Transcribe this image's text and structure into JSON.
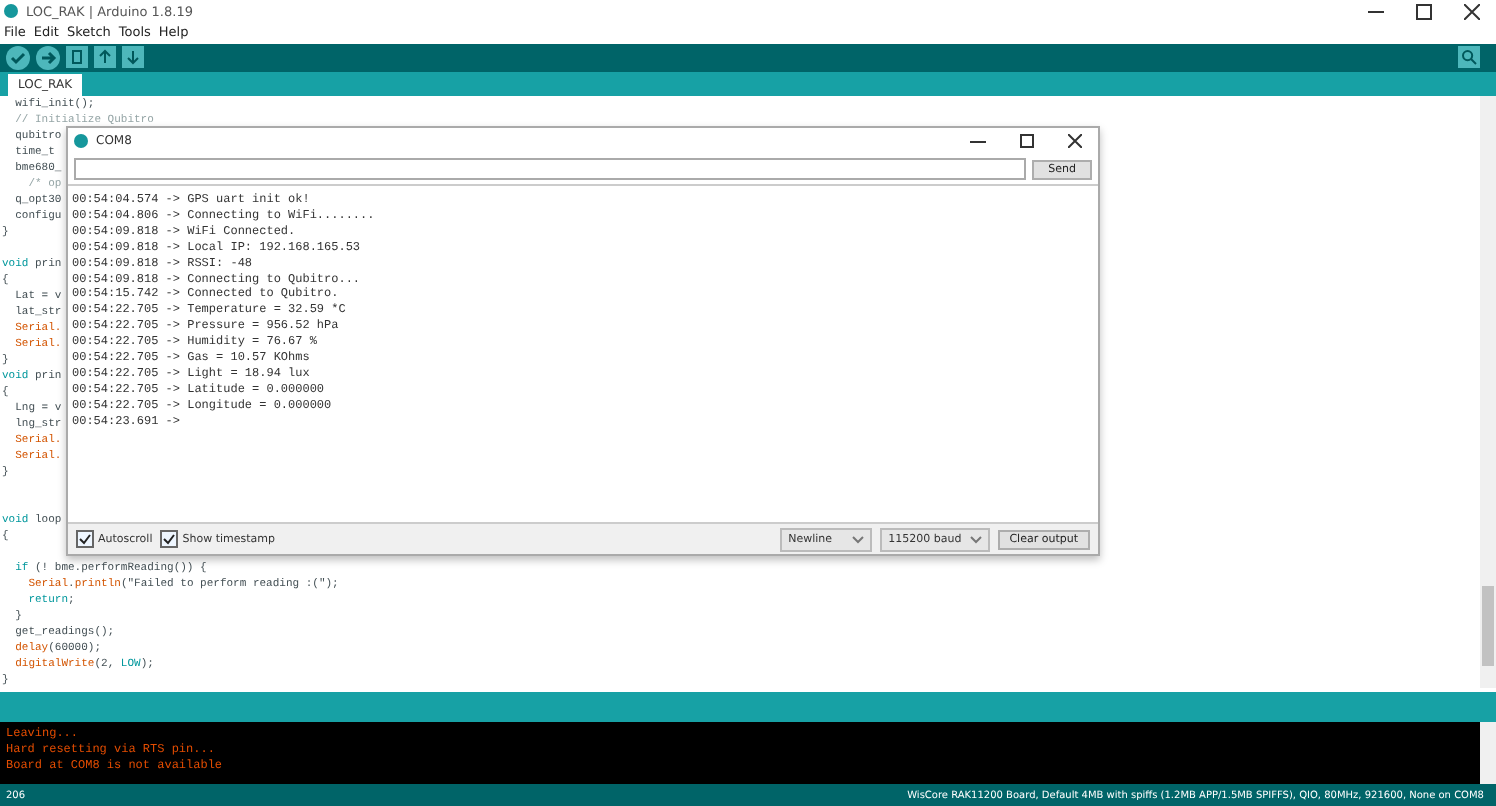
{
  "window": {
    "title": "LOC_RAK | Arduino 1.8.19"
  },
  "menu": [
    "File",
    "Edit",
    "Sketch",
    "Tools",
    "Help"
  ],
  "toolbar": [
    {
      "kind": "verify"
    },
    {
      "kind": "upload"
    },
    {
      "kind": "new"
    },
    {
      "kind": "open"
    },
    {
      "kind": "save"
    }
  ],
  "tabs": [
    {
      "label": "LOC_RAK",
      "selected": true
    }
  ],
  "editor": {
    "lines": [
      {
        "kind": "code",
        "tokens": [
          {
            "text": "  wifi_init();",
            "kind": "plain"
          }
        ]
      },
      {
        "kind": "code",
        "tokens": [
          {
            "text": "  // Initialize Qubitro",
            "kind": "comment"
          }
        ]
      },
      {
        "kind": "code",
        "tokens": [
          {
            "text": "  qubitro",
            "kind": "plain"
          }
        ]
      },
      {
        "kind": "code",
        "tokens": [
          {
            "text": "  time_t",
            "kind": "plain"
          }
        ]
      },
      {
        "kind": "code",
        "tokens": [
          {
            "text": "  bme680_",
            "kind": "plain"
          }
        ]
      },
      {
        "kind": "code",
        "tokens": [
          {
            "text": "    /* op",
            "kind": "comment"
          }
        ]
      },
      {
        "kind": "code",
        "tokens": [
          {
            "text": "  q_opt30",
            "kind": "plain"
          }
        ]
      },
      {
        "kind": "code",
        "tokens": [
          {
            "text": "  configu",
            "kind": "plain"
          }
        ]
      },
      {
        "kind": "code",
        "tokens": [
          {
            "text": "}",
            "kind": "plain"
          }
        ]
      },
      {
        "kind": "blank"
      },
      {
        "kind": "code",
        "tokens": [
          {
            "text": "void",
            "kind": "keyword"
          },
          {
            "text": " prin",
            "kind": "plain"
          }
        ]
      },
      {
        "kind": "code",
        "tokens": [
          {
            "text": "{",
            "kind": "plain"
          }
        ]
      },
      {
        "kind": "code",
        "tokens": [
          {
            "text": "  Lat = v",
            "kind": "plain"
          }
        ]
      },
      {
        "kind": "code",
        "tokens": [
          {
            "text": "  lat_str",
            "kind": "plain"
          }
        ]
      },
      {
        "kind": "code",
        "tokens": [
          {
            "text": "  Serial.",
            "kind": "function"
          }
        ]
      },
      {
        "kind": "code",
        "tokens": [
          {
            "text": "  Serial.",
            "kind": "function"
          }
        ]
      },
      {
        "kind": "code",
        "tokens": [
          {
            "text": "}",
            "kind": "plain"
          }
        ]
      },
      {
        "kind": "code",
        "tokens": [
          {
            "text": "void",
            "kind": "keyword"
          },
          {
            "text": " prin",
            "kind": "plain"
          }
        ]
      },
      {
        "kind": "code",
        "tokens": [
          {
            "text": "{",
            "kind": "plain"
          }
        ]
      },
      {
        "kind": "code",
        "tokens": [
          {
            "text": "  Lng = v",
            "kind": "plain"
          }
        ]
      },
      {
        "kind": "code",
        "tokens": [
          {
            "text": "  lng_str",
            "kind": "plain"
          }
        ]
      },
      {
        "kind": "code",
        "tokens": [
          {
            "text": "  Serial.",
            "kind": "function"
          }
        ]
      },
      {
        "kind": "code",
        "tokens": [
          {
            "text": "  Serial.",
            "kind": "function"
          }
        ]
      },
      {
        "kind": "code",
        "tokens": [
          {
            "text": "}",
            "kind": "plain"
          }
        ]
      },
      {
        "kind": "blank"
      },
      {
        "kind": "blank"
      },
      {
        "kind": "code",
        "tokens": [
          {
            "text": "void",
            "kind": "keyword"
          },
          {
            "text": " loop",
            "kind": "plain"
          }
        ]
      },
      {
        "kind": "code",
        "tokens": [
          {
            "text": "{",
            "kind": "plain"
          }
        ]
      },
      {
        "kind": "blank"
      },
      {
        "kind": "code",
        "tokens": [
          {
            "text": "  if",
            "kind": "keyword"
          },
          {
            "text": " (! bme.performReading()) {",
            "kind": "plain"
          }
        ]
      },
      {
        "kind": "code",
        "tokens": [
          {
            "text": "    Serial",
            "kind": "function"
          },
          {
            "text": ".",
            "kind": "plain"
          },
          {
            "text": "println",
            "kind": "function"
          },
          {
            "text": "(\"Failed to perform reading :(\");",
            "kind": "plain"
          }
        ]
      },
      {
        "kind": "code",
        "tokens": [
          {
            "text": "    return",
            "kind": "keyword"
          },
          {
            "text": ";",
            "kind": "plain"
          }
        ]
      },
      {
        "kind": "code",
        "tokens": [
          {
            "text": "  }",
            "kind": "plain"
          }
        ]
      },
      {
        "kind": "code",
        "tokens": [
          {
            "text": "  get_readings();",
            "kind": "plain"
          }
        ]
      },
      {
        "kind": "code",
        "tokens": [
          {
            "text": "  delay",
            "kind": "function"
          },
          {
            "text": "(60000);",
            "kind": "plain"
          }
        ]
      },
      {
        "kind": "code",
        "tokens": [
          {
            "text": "  digitalWrite",
            "kind": "function"
          },
          {
            "text": "(2, ",
            "kind": "plain"
          },
          {
            "text": "LOW",
            "kind": "constant"
          },
          {
            "text": ");",
            "kind": "plain"
          }
        ]
      },
      {
        "kind": "code",
        "tokens": [
          {
            "text": "}",
            "kind": "plain"
          }
        ]
      }
    ]
  },
  "serial_monitor": {
    "title": "COM8",
    "send_button": "Send",
    "output": [
      "00:54:04.574 -> GPS uart init ok!",
      "00:54:04.806 -> Connecting to WiFi........",
      "00:54:09.818 -> WiFi Connected.",
      "00:54:09.818 -> Local IP: 192.168.165.53",
      "00:54:09.818 -> RSSI: -48",
      "00:54:09.818 -> Connecting to Qubitro...",
      "00:54:15.742 -> Connected to Qubitro.",
      "00:54:22.705 -> Temperature = 32.59 *C",
      "00:54:22.705 -> Pressure = 956.52 hPa",
      "00:54:22.705 -> Humidity = 76.67 %",
      "00:54:22.705 -> Gas = 10.57 KOhms",
      "00:54:22.705 -> Light = 18.94 lux",
      "00:54:22.705 -> Latitude = 0.000000",
      "00:54:22.705 -> Longitude = 0.000000",
      "00:54:23.691 ->"
    ],
    "options": [
      {
        "label": "Autoscroll",
        "checked": true
      },
      {
        "label": "Show timestamp",
        "checked": true
      }
    ],
    "line_ending": "Newline",
    "baud": "115200 baud",
    "clear_button": "Clear output"
  },
  "console": [
    "Leaving...",
    "Hard resetting via RTS pin...",
    "Board at COM8 is not available"
  ],
  "status_bar": {
    "line": "206",
    "board": "WisCore RAK11200 Board, Default 4MB with spiffs (1.2MB APP/1.5MB SPIFFS), QIO, 80MHz, 921600, None on COM8"
  }
}
